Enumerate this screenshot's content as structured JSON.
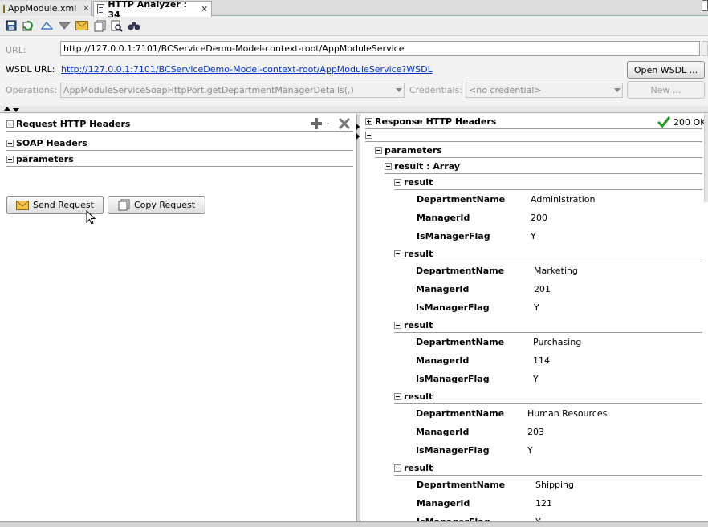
{
  "tabs": [
    {
      "label": "AppModule.xml",
      "close": "×"
    },
    {
      "label": "HTTP Analyzer : 34",
      "close": "×"
    }
  ],
  "toolbar": {
    "icons": [
      "save-icon",
      "refresh-icon",
      "upload-icon",
      "download-icon",
      "email-icon",
      "copy-icon",
      "document-icon",
      "zoom-icon",
      "binoculars-icon"
    ]
  },
  "form": {
    "url_label": "URL:",
    "url_value": "http://127.0.0.1:7101/BCServiceDemo-Model-context-root/AppModuleService",
    "wsdl_label": "WSDL URL:",
    "wsdl_value": "http://127.0.0.1:7101/BCServiceDemo-Model-context-root/AppModuleService?WSDL",
    "open_wsdl": "Open WSDL ...",
    "operations_label": "Operations:",
    "operations_value": "AppModuleServiceSoapHttpPort.getDepartmentManagerDetails(,)",
    "credentials_label": "Credentials:",
    "credentials_value": "<no credential>",
    "new_button": "New ..."
  },
  "request": {
    "sections": [
      "Request HTTP Headers",
      "SOAP Headers",
      "parameters"
    ],
    "send_button": "Send Request",
    "copy_button": "Copy Request"
  },
  "response": {
    "headers_label": "Response HTTP Headers",
    "status": "200 OK",
    "parameters_label": "parameters",
    "result_array_label": "result : Array",
    "result_label": "result",
    "field_names": [
      "DepartmentName",
      "ManagerId",
      "IsManagerFlag"
    ],
    "results": [
      {
        "DepartmentName": "Administration",
        "ManagerId": "200",
        "IsManagerFlag": "Y"
      },
      {
        "DepartmentName": "Marketing",
        "ManagerId": "201",
        "IsManagerFlag": "Y"
      },
      {
        "DepartmentName": "Purchasing",
        "ManagerId": "114",
        "IsManagerFlag": "Y"
      },
      {
        "DepartmentName": "Human Resources",
        "ManagerId": "203",
        "IsManagerFlag": "Y"
      },
      {
        "DepartmentName": "Shipping",
        "ManagerId": "121",
        "IsManagerFlag": "Y"
      }
    ]
  }
}
